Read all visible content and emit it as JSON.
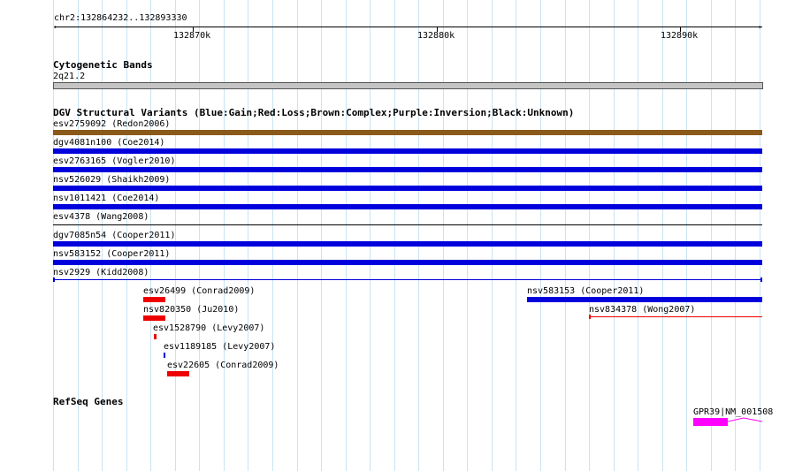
{
  "ruler": {
    "location": "chr2:132864232..132893330",
    "tick_labels": [
      "132870k",
      "132880k",
      "132890k"
    ]
  },
  "cytogenetic": {
    "title": "Cytogenetic Bands",
    "band": "2q21.2"
  },
  "dgv": {
    "title": "DGV Structural Variants (Blue:Gain;Red:Loss;Brown:Complex;Purple:Inversion;Black:Unknown)",
    "colors": {
      "gain": "#0000dd",
      "loss": "#ee0000",
      "complex": "#8b5a1b",
      "unknown": "#000000"
    },
    "variants": [
      {
        "label": "esv2759092 (Redon2006)",
        "type": "complex"
      },
      {
        "label": "dgv4081n100 (Coe2014)",
        "type": "gain"
      },
      {
        "label": "esv2763165 (Vogler2010)",
        "type": "gain"
      },
      {
        "label": "nsv526029 (Shaikh2009)",
        "type": "gain"
      },
      {
        "label": "nsv1011421 (Coe2014)",
        "type": "gain"
      },
      {
        "label": "esv4378 (Wang2008)",
        "type": "unknown"
      },
      {
        "label": "dgv7085n54 (Cooper2011)",
        "type": "gain"
      },
      {
        "label": "nsv583152 (Cooper2011)",
        "type": "gain"
      },
      {
        "label": "nsv2929 (Kidd2008)",
        "type": "gain"
      },
      {
        "label": "esv26499 (Conrad2009)",
        "type": "loss"
      },
      {
        "label": "nsv820350 (Ju2010)",
        "type": "loss"
      },
      {
        "label": "esv1528790 (Levy2007)",
        "type": "loss"
      },
      {
        "label": "esv1189185 (Levy2007)",
        "type": "gain"
      },
      {
        "label": "esv22605 (Conrad2009)",
        "type": "loss"
      },
      {
        "label": "nsv583153 (Cooper2011)",
        "type": "gain"
      },
      {
        "label": "nsv834378 (Wong2007)",
        "type": "loss"
      }
    ]
  },
  "refseq": {
    "title": "RefSeq Genes",
    "gene_label": "GPR39|NM_001508",
    "gene_color": "#ff00ff"
  }
}
